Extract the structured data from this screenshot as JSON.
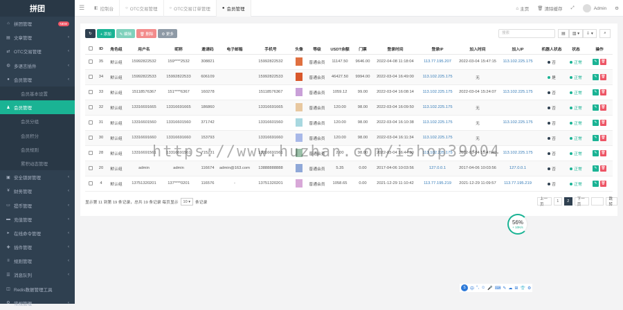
{
  "sidebar": {
    "logo": "拼团",
    "items": [
      {
        "label": "拼团管理",
        "icon": "home-icon",
        "badge": "NEW",
        "type": "top"
      },
      {
        "label": "文章管理",
        "icon": "file-icon",
        "type": "top",
        "arrow": true
      },
      {
        "label": "OTC交易管理",
        "icon": "exchange-icon",
        "type": "top",
        "arrow": true
      },
      {
        "label": "多语言插件",
        "icon": "globe-icon",
        "type": "top",
        "arrow": true
      },
      {
        "label": "会员管理",
        "icon": "user-icon",
        "type": "top",
        "arrow": true
      },
      {
        "label": "会员基本设置",
        "icon": "",
        "type": "sub"
      },
      {
        "label": "会员管理",
        "icon": "users-icon",
        "type": "active"
      },
      {
        "label": "会员分组",
        "icon": "",
        "type": "sub"
      },
      {
        "label": "会员积分",
        "icon": "",
        "type": "sub"
      },
      {
        "label": "会员规则",
        "icon": "",
        "type": "sub"
      },
      {
        "label": "累积动态管理",
        "icon": "",
        "type": "sub"
      },
      {
        "label": "安全锁屏管理",
        "icon": "lock-icon",
        "type": "top",
        "arrow": true
      },
      {
        "label": "财务管理",
        "icon": "money-icon",
        "type": "top",
        "arrow": true
      },
      {
        "label": "提币管理",
        "icon": "wallet-icon",
        "type": "top",
        "arrow": true
      },
      {
        "label": "充值管理",
        "icon": "credit-card-icon",
        "type": "top",
        "arrow": true
      },
      {
        "label": "在线命令管理",
        "icon": "terminal-icon",
        "type": "top",
        "arrow": true
      },
      {
        "label": "插件管理",
        "icon": "plugin-icon",
        "type": "top",
        "arrow": true
      },
      {
        "label": "规则管理",
        "icon": "list-icon",
        "type": "top",
        "arrow": true
      },
      {
        "label": "消息队列",
        "icon": "queue-icon",
        "type": "top",
        "arrow": true
      },
      {
        "label": "Redis数据管理工具",
        "icon": "database-icon",
        "type": "top",
        "arrow": false
      },
      {
        "label": "常规管理",
        "icon": "cog-icon",
        "type": "top",
        "arrow": true
      }
    ]
  },
  "topbar": {
    "tabs": [
      {
        "label": "控制台",
        "icon": "dashboard-icon",
        "active": false
      },
      {
        "label": "OTC交易管理",
        "icon": "circle-icon",
        "active": false
      },
      {
        "label": "OTC交易订单管理",
        "icon": "circle-icon",
        "active": false
      },
      {
        "label": "会员管理",
        "icon": "user-icon",
        "active": true
      }
    ],
    "right": {
      "home": "主页",
      "clear": "清除缓存",
      "user": "Admin"
    }
  },
  "toolbar": {
    "add": "+ 添加",
    "edit": "✎ 编辑",
    "delete": "🗑 删除",
    "more": "⚙ 更多",
    "search_placeholder": "搜索"
  },
  "table": {
    "columns": [
      "",
      "ID",
      "角色组",
      "用户名",
      "昵称",
      "邀请码",
      "电子邮箱",
      "手机号",
      "头像",
      "等级",
      "USDT余额",
      "门票",
      "登录时间",
      "登录IP",
      "加入时间",
      "加入IP",
      "机器人状态",
      "状态",
      "操作"
    ],
    "rows": [
      {
        "id": "35",
        "group": "默认组",
        "username": "15992822532",
        "nickname": "159****2532",
        "invite": "308821",
        "email": "",
        "mobile": "15992822532",
        "avatar_color": "#e07040",
        "level": "普通会员",
        "usdt": "11147.50",
        "ticket": "9646.00",
        "login_time": "2022-04-08 11:18:04",
        "login_ip": "113.77.195.207",
        "join_time": "2022-03-04 15:47:15",
        "join_ip": "113.102.225.175",
        "robot": "否",
        "robot_color": "#2f4050",
        "status": "正常"
      },
      {
        "id": "34",
        "group": "默认组",
        "username": "15992822533",
        "nickname": "15992822533",
        "invite": "606109",
        "email": "",
        "mobile": "15992822533",
        "avatar_color": "#d9582b",
        "level": "普通会员",
        "usdt": "46427.50",
        "ticket": "9994.00",
        "login_time": "2022-03-04 16:49:00",
        "login_ip": "113.102.225.175",
        "join_time": "无",
        "join_ip": "",
        "robot": "是",
        "robot_color": "#1ab394",
        "status": "正常"
      },
      {
        "id": "33",
        "group": "默认组",
        "username": "15118576367",
        "nickname": "151****6367",
        "invite": "160278",
        "email": "",
        "mobile": "15118576367",
        "avatar_color": "#c9a0d8",
        "level": "普通会员",
        "usdt": "1059.12",
        "ticket": "99.00",
        "login_time": "2022-03-04 16:08:14",
        "login_ip": "113.102.225.175",
        "join_time": "2022-03-04 15:24:07",
        "join_ip": "113.102.225.175",
        "robot": "否",
        "robot_color": "#2f4050",
        "status": "正常"
      },
      {
        "id": "32",
        "group": "默认组",
        "username": "13316691665",
        "nickname": "13316691665",
        "invite": "186860",
        "email": "",
        "mobile": "13316691665",
        "avatar_color": "#e8c8a0",
        "level": "普通会员",
        "usdt": "120.00",
        "ticket": "98.00",
        "login_time": "2022-03-04 16:09:50",
        "login_ip": "113.102.225.175",
        "join_time": "无",
        "join_ip": "",
        "robot": "否",
        "robot_color": "#2f4050",
        "status": "正常"
      },
      {
        "id": "31",
        "group": "默认组",
        "username": "13316601560",
        "nickname": "13316601560",
        "invite": "371742",
        "email": "",
        "mobile": "13316601560",
        "avatar_color": "#a8d8e0",
        "level": "普通会员",
        "usdt": "120.00",
        "ticket": "98.00",
        "login_time": "2022-03-04 16:10:38",
        "login_ip": "113.102.225.175",
        "join_time": "无",
        "join_ip": "113.102.225.175",
        "robot": "否",
        "robot_color": "#2f4050",
        "status": "正常"
      },
      {
        "id": "30",
        "group": "默认组",
        "username": "13316691660",
        "nickname": "13316691660",
        "invite": "153793",
        "email": "",
        "mobile": "13316691660",
        "avatar_color": "#a8b8e8",
        "level": "普通会员",
        "usdt": "120.00",
        "ticket": "98.00",
        "login_time": "2022-03-04 16:11:34",
        "login_ip": "113.102.225.175",
        "join_time": "无",
        "join_ip": "",
        "robot": "否",
        "robot_color": "#2f4050",
        "status": "正常"
      },
      {
        "id": "28",
        "group": "默认组",
        "username": "13316691561",
        "nickname": "13316691561",
        "invite": "715231",
        "email": "",
        "mobile": "13316691561",
        "avatar_color": "#9ac0a8",
        "level": "普通会员",
        "usdt": "2.00",
        "ticket": "98.00",
        "login_time": "2022-03-04 16:44:30",
        "login_ip": "113.102.225.175",
        "join_time": "2022-03-04 15:47:40",
        "join_ip": "113.102.225.175",
        "robot": "否",
        "robot_color": "#2f4050",
        "status": "正常"
      },
      {
        "id": "20",
        "group": "默认组",
        "username": "admin",
        "nickname": "admin",
        "invite": "116674",
        "email": "admin@163.com",
        "mobile": "13888888888",
        "avatar_color": "#8fa8d8",
        "level": "普通会员",
        "usdt": "5.35",
        "ticket": "0.00",
        "login_time": "2017-04-06 10:03:56",
        "login_ip": "127.0.0.1",
        "join_time": "2017-04-06 10:03:56",
        "join_ip": "127.0.0.1",
        "robot": "否",
        "robot_color": "#2f4050",
        "status": "正常"
      },
      {
        "id": "4",
        "group": "默认组",
        "username": "13751320201",
        "nickname": "137****0201",
        "invite": "116576",
        "email": "-",
        "mobile": "13751320201",
        "avatar_color": "#d8a8d8",
        "level": "普通会员",
        "usdt": "1058.65",
        "ticket": "0.00",
        "login_time": "2021-12-29 11:10:42",
        "login_ip": "113.77.195.219",
        "join_time": "2021-12-29 11:09:57",
        "join_ip": "113.77.195.219",
        "robot": "否",
        "robot_color": "#2f4050",
        "status": "正常"
      }
    ]
  },
  "footer": {
    "summary": "显示第 11 到第 19 条记录，总共 19 条记录 每页显示",
    "page_size": "10",
    "suffix": "条记录"
  },
  "pager": {
    "prev": "上一页",
    "pages": [
      "1",
      "2"
    ],
    "current": "2",
    "next": "下一页",
    "jump": "跳转"
  },
  "gauge": {
    "percent": "56%",
    "speed": "+ 10K/s"
  },
  "watermark": "https://www.huzhan.com/ishop39004",
  "ime": {
    "logo": "S",
    "icons": [
      "中",
      "°,",
      "☺",
      "🎤",
      "⌨",
      "✎",
      "☁",
      "⊞",
      "👕",
      "⚙"
    ]
  }
}
